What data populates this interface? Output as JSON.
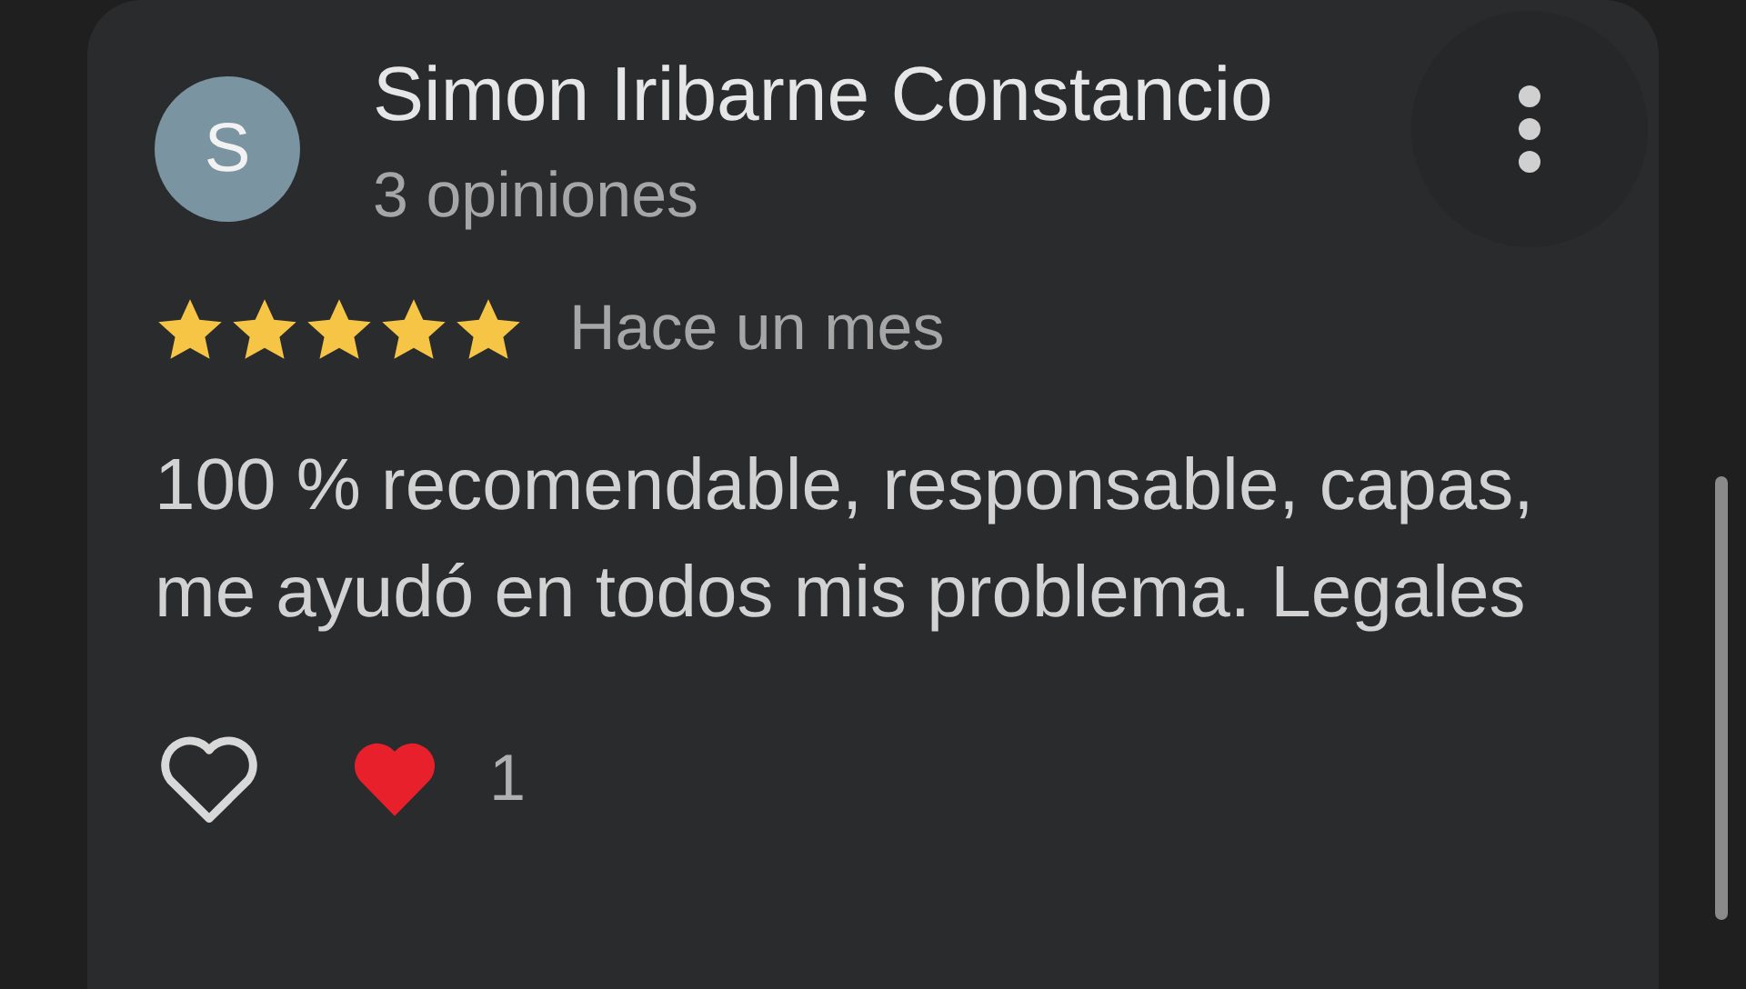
{
  "review": {
    "avatar_letter": "S",
    "author": "Simon Iribarne Constancio",
    "author_meta": "3 opiniones",
    "stars": 5,
    "date": "Hace un mes",
    "text": "100 % recomendable, responsable, capas, me ayudó en todos mis problema. Legales",
    "reactions": [
      {
        "kind": "like"
      },
      {
        "kind": "heart",
        "count": "1"
      }
    ]
  }
}
